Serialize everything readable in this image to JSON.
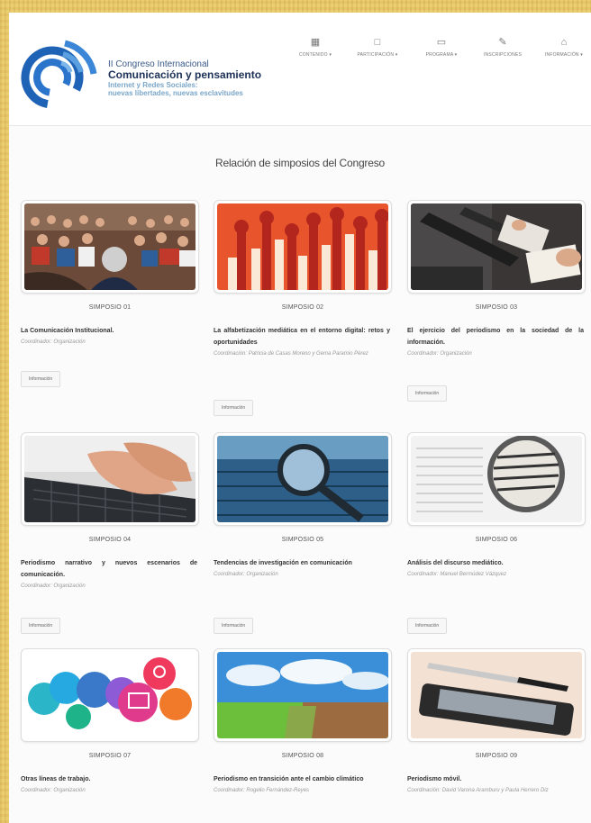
{
  "header": {
    "title_line1": "II Congreso Internacional",
    "title_line2": "Comunicación y pensamiento",
    "title_line3": "Internet y Redes Sociales:",
    "title_line4": "nuevas libertades, nuevas esclavitudes"
  },
  "nav": [
    {
      "label": "CONTENIDO ▾",
      "icon": "bar-chart-icon"
    },
    {
      "label": "PARTICIPACIÓN ▾",
      "icon": "users-icon"
    },
    {
      "label": "PROGRAMA ▾",
      "icon": "monitor-icon"
    },
    {
      "label": "INSCRIPCIONES",
      "icon": "pen-icon"
    },
    {
      "label": "INFORMACIÓN ▾",
      "icon": "home-icon"
    }
  ],
  "section_title": "Relación de simposios del Congreso",
  "button_label": "Información",
  "symposia": [
    {
      "number": "SIMPOSIO 01",
      "title": "La Comunicación Institucional.",
      "coordinator": "Coordinador: Organización",
      "image": "audience-photo",
      "has_button": true
    },
    {
      "number": "SIMPOSIO 02",
      "title": "La alfabetización mediática en el entorno digital: retos y oportunidades",
      "coordinator": "Coordinación: Patricia de Casas Moreno y Gema Paramio Pérez",
      "image": "raised-hands-illustration",
      "has_button": true
    },
    {
      "number": "SIMPOSIO 03",
      "title": "El ejercicio del periodismo en la sociedad de la información.",
      "coordinator": "Coordinador: Organización",
      "image": "journalists-photo",
      "has_button": true
    },
    {
      "number": "SIMPOSIO 04",
      "title": "Periodismo narrativo y nuevos escenarios de comunicación.",
      "coordinator": "Coordinador: Organización",
      "image": "typing-keyboard-photo",
      "has_button": true
    },
    {
      "number": "SIMPOSIO 05",
      "title": "Tendencias de investigación en comunicación",
      "coordinator": "Coordinador: Organización",
      "image": "magnifier-keyboard-photo",
      "has_button": true
    },
    {
      "number": "SIMPOSIO 06",
      "title": "Análisis del discurso mediático.",
      "coordinator": "Coordinador: Manuel Bermúdez Vázquez",
      "image": "magnified-text-photo",
      "has_button": true
    },
    {
      "number": "SIMPOSIO 07",
      "title": "Otras líneas de trabajo.",
      "coordinator": "Coordinador: Organización",
      "image": "social-bubbles-illustration",
      "has_button": false
    },
    {
      "number": "SIMPOSIO 08",
      "title": "Periodismo en transición ante el cambio climático",
      "coordinator": "Coordinador: Rogelio Fernández-Reyes",
      "image": "landscape-photo",
      "has_button": false
    },
    {
      "number": "SIMPOSIO 09",
      "title": "Periodismo móvil.",
      "coordinator": "Coordinación: David Varona Aramburu y Paula Herrero Diz",
      "image": "phone-pen-photo",
      "has_button": false
    }
  ]
}
